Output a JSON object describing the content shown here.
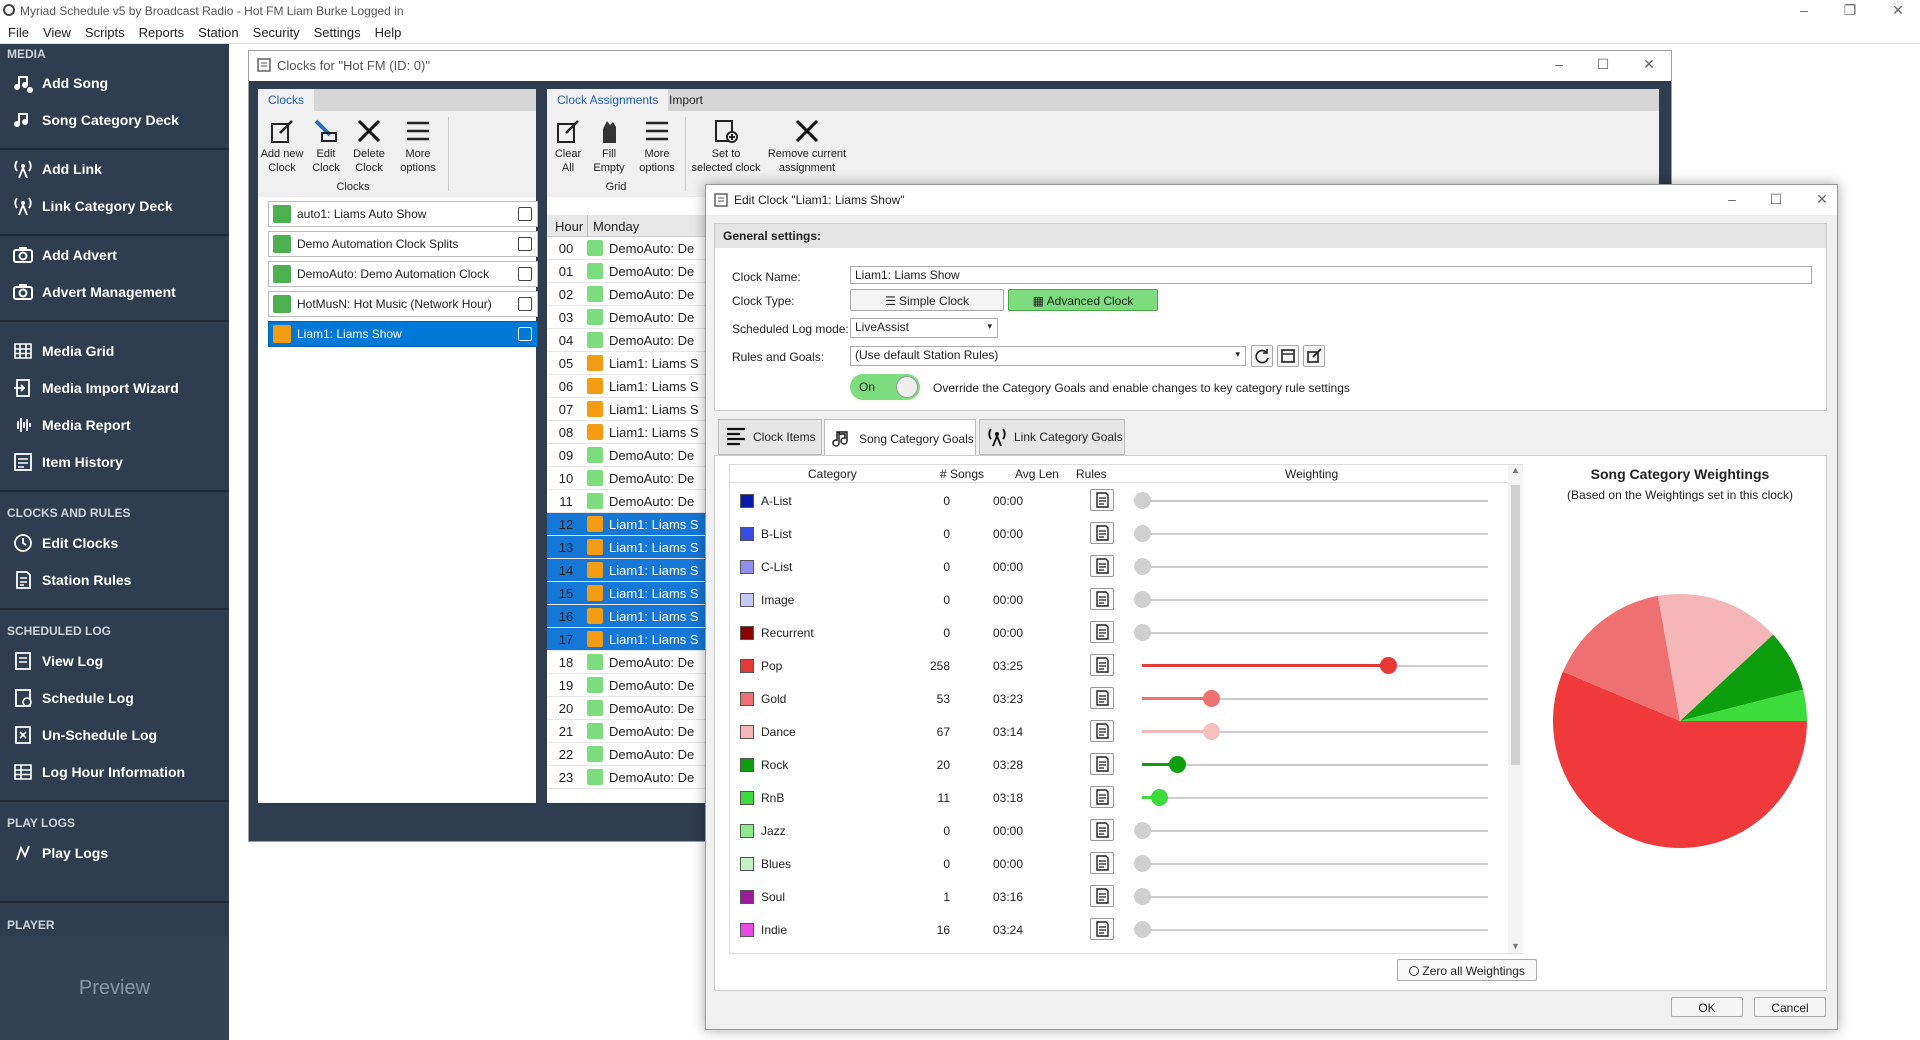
{
  "app": {
    "title": "Myriad Schedule v5 by Broadcast Radio - Hot FM Liam Burke Logged in",
    "menu": [
      "File",
      "View",
      "Scripts",
      "Reports",
      "Station",
      "Security",
      "Settings",
      "Help"
    ]
  },
  "sidebar": {
    "sections": [
      {
        "title": "MEDIA",
        "items": [
          {
            "label": "Add Song",
            "icon": "music-note-icon"
          },
          {
            "label": "Song Category Deck",
            "icon": "music-note-icon"
          },
          {
            "label": "Add Link",
            "icon": "antenna-icon"
          },
          {
            "label": "Link Category Deck",
            "icon": "antenna-icon"
          },
          {
            "label": "Add Advert",
            "icon": "camera-icon"
          },
          {
            "label": "Advert Management",
            "icon": "camera-icon"
          },
          {
            "label": "Media Grid",
            "icon": "grid-icon"
          },
          {
            "label": "Media Import Wizard",
            "icon": "import-icon"
          },
          {
            "label": "Media Report",
            "icon": "waveform-icon"
          },
          {
            "label": "Item History",
            "icon": "history-icon"
          }
        ]
      },
      {
        "title": "CLOCKS AND RULES",
        "items": [
          {
            "label": "Edit Clocks",
            "icon": "clock-icon"
          },
          {
            "label": "Station Rules",
            "icon": "rules-icon"
          }
        ]
      },
      {
        "title": "SCHEDULED LOG",
        "items": [
          {
            "label": "View Log",
            "icon": "log-icon"
          },
          {
            "label": "Schedule Log",
            "icon": "schedule-icon"
          },
          {
            "label": "Un-Schedule Log",
            "icon": "unschedule-icon"
          },
          {
            "label": "Log Hour Information",
            "icon": "table-icon"
          }
        ]
      },
      {
        "title": "PLAY LOGS",
        "items": [
          {
            "label": "Play Logs",
            "icon": "play-logs-icon"
          }
        ]
      },
      {
        "title": "PLAYER",
        "items": []
      }
    ],
    "preview_label": "Preview"
  },
  "clocks_window": {
    "title": "Clocks for \"Hot FM (ID: 0)\"",
    "tab_clocks": "Clocks",
    "ribbon_clocks": {
      "buttons": [
        "Add new Clock",
        "Edit Clock",
        "Delete Clock",
        "More options"
      ],
      "group_label": "Clocks"
    },
    "clock_list": [
      {
        "label": "auto1: Liams Auto Show",
        "color": "#4caf50",
        "selected": false
      },
      {
        "label": "Demo Automation Clock Splits",
        "color": "#4caf50",
        "selected": false
      },
      {
        "label": "DemoAuto: Demo Automation Clock",
        "color": "#4caf50",
        "selected": false
      },
      {
        "label": "HotMusN: Hot Music (Network Hour)",
        "color": "#4caf50",
        "selected": false
      },
      {
        "label": "Liam1: Liams Show",
        "color": "#f39c12",
        "selected": true
      }
    ],
    "tabs_right": [
      "Clock Assignments",
      "Import"
    ],
    "ribbon_grid": {
      "buttons": [
        "Clear All",
        "Fill Empty",
        "More options",
        "Set to selected clock",
        "Remove current assignment"
      ],
      "group_label": "Grid"
    },
    "grid_headers": [
      "Hour",
      "Monday"
    ],
    "hours": [
      {
        "h": "00",
        "text": "DemoAuto: De",
        "kind": "demo"
      },
      {
        "h": "01",
        "text": "DemoAuto: De",
        "kind": "demo"
      },
      {
        "h": "02",
        "text": "DemoAuto: De",
        "kind": "demo"
      },
      {
        "h": "03",
        "text": "DemoAuto: De",
        "kind": "demo"
      },
      {
        "h": "04",
        "text": "DemoAuto: De",
        "kind": "demo"
      },
      {
        "h": "05",
        "text": "Liam1: Liams S",
        "kind": "liam"
      },
      {
        "h": "06",
        "text": "Liam1: Liams S",
        "kind": "liam"
      },
      {
        "h": "07",
        "text": "Liam1: Liams S",
        "kind": "liam"
      },
      {
        "h": "08",
        "text": "Liam1: Liams S",
        "kind": "liam"
      },
      {
        "h": "09",
        "text": "DemoAuto: De",
        "kind": "demo"
      },
      {
        "h": "10",
        "text": "DemoAuto: De",
        "kind": "demo"
      },
      {
        "h": "11",
        "text": "DemoAuto: De",
        "kind": "demo"
      },
      {
        "h": "12",
        "text": "Liam1: Liams S",
        "kind": "liam-sel"
      },
      {
        "h": "13",
        "text": "Liam1: Liams S",
        "kind": "liam-sel"
      },
      {
        "h": "14",
        "text": "Liam1: Liams S",
        "kind": "liam-sel"
      },
      {
        "h": "15",
        "text": "Liam1: Liams S",
        "kind": "liam-sel"
      },
      {
        "h": "16",
        "text": "Liam1: Liams S",
        "kind": "liam-sel"
      },
      {
        "h": "17",
        "text": "Liam1: Liams S",
        "kind": "liam-sel"
      },
      {
        "h": "18",
        "text": "DemoAuto: De",
        "kind": "demo"
      },
      {
        "h": "19",
        "text": "DemoAuto: De",
        "kind": "demo"
      },
      {
        "h": "20",
        "text": "DemoAuto: De",
        "kind": "demo"
      },
      {
        "h": "21",
        "text": "DemoAuto: De",
        "kind": "demo"
      },
      {
        "h": "22",
        "text": "DemoAuto: De",
        "kind": "demo"
      },
      {
        "h": "23",
        "text": "DemoAuto: De",
        "kind": "demo"
      }
    ]
  },
  "edit_clock": {
    "title": "Edit Clock \"Liam1: Liams Show\"",
    "general_header": "General settings:",
    "clock_name_label": "Clock Name:",
    "clock_name_value": "Liam1: Liams Show",
    "clock_type_label": "Clock Type:",
    "simple_clock": "Simple Clock",
    "advanced_clock": "Advanced Clock",
    "log_mode_label": "Scheduled Log mode:",
    "log_mode_value": "LiveAssist",
    "rules_label": "Rules and Goals:",
    "rules_value": "(Use default Station Rules)",
    "toggle_label": "On",
    "toggle_desc": "Override the Category Goals and enable changes to key category rule settings",
    "tabs": [
      "Clock Items",
      "Song Category Goals",
      "Link Category Goals"
    ],
    "columns": [
      "Category",
      "# Songs",
      "Avg Len",
      "Rules",
      "Weighting"
    ],
    "categories": [
      {
        "name": "A-List",
        "songs": "0",
        "avg": "00:00",
        "color": "#0a1aa8",
        "weight": 0
      },
      {
        "name": "B-List",
        "songs": "0",
        "avg": "00:00",
        "color": "#3a4be0",
        "weight": 0
      },
      {
        "name": "C-List",
        "songs": "0",
        "avg": "00:00",
        "color": "#8f8ff0",
        "weight": 0
      },
      {
        "name": "Image",
        "songs": "0",
        "avg": "00:00",
        "color": "#c8c8f5",
        "weight": 0
      },
      {
        "name": "Recurrent",
        "songs": "0",
        "avg": "00:00",
        "color": "#8b0000",
        "weight": 0
      },
      {
        "name": "Pop",
        "songs": "258",
        "avg": "03:25",
        "color": "#e53935",
        "weight": 71
      },
      {
        "name": "Gold",
        "songs": "53",
        "avg": "03:23",
        "color": "#ef7070",
        "weight": 20
      },
      {
        "name": "Dance",
        "songs": "67",
        "avg": "03:14",
        "color": "#f4b6b6",
        "weight": 20
      },
      {
        "name": "Rock",
        "songs": "20",
        "avg": "03:28",
        "color": "#0d9e0d",
        "weight": 10
      },
      {
        "name": "RnB",
        "songs": "11",
        "avg": "03:18",
        "color": "#3ddc3d",
        "weight": 5
      },
      {
        "name": "Jazz",
        "songs": "0",
        "avg": "00:00",
        "color": "#8ee88e",
        "weight": 0
      },
      {
        "name": "Blues",
        "songs": "0",
        "avg": "00:00",
        "color": "#c6f0c6",
        "weight": 0
      },
      {
        "name": "Soul",
        "songs": "1",
        "avg": "03:16",
        "color": "#9c1a9c",
        "weight": 0
      },
      {
        "name": "Indie",
        "songs": "16",
        "avg": "03:24",
        "color": "#e84ae8",
        "weight": 0
      }
    ],
    "pie_title": "Song Category Weightings",
    "pie_subtitle": "(Based on the Weightings set in this clock)",
    "zero_button": "Zero all Weightings",
    "ok": "OK",
    "cancel": "Cancel"
  },
  "chart_data": {
    "type": "pie",
    "title": "Song Category Weightings",
    "subtitle": "(Based on the Weightings set in this clock)",
    "categories": [
      "Pop",
      "Gold",
      "Dance",
      "Rock",
      "RnB"
    ],
    "values": [
      71,
      20,
      20,
      10,
      5
    ],
    "colors": [
      "#f0393b",
      "#ef7070",
      "#f4b6b6",
      "#0d9e0d",
      "#3ddc3d"
    ]
  }
}
